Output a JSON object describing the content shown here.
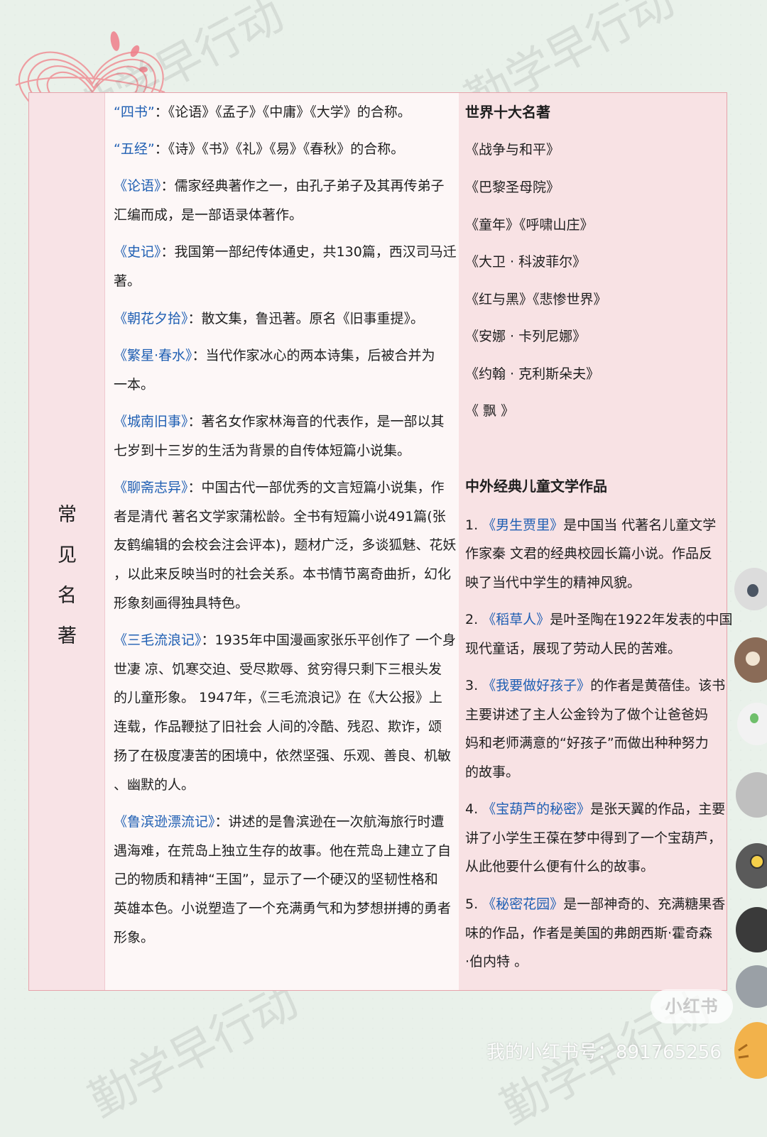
{
  "watermark": "勤学早行动",
  "title_chars": [
    "常",
    "见",
    "名",
    "著"
  ],
  "left_lines": [
    [
      {
        "t": "“四书”",
        "c": true
      },
      {
        "t": "：《论语》《孟子》《中庸》《大学》的合称。"
      }
    ],
    [
      {
        "t": "“五经”",
        "c": true
      },
      {
        "t": "：《诗》《书》《礼》《易》《春秋》的合称。"
      }
    ],
    [
      {
        "t": "《论语》",
        "c": true
      },
      {
        "t": "：儒家经典著作之一，由孔子弟子及其再传弟子"
      }
    ],
    [
      {
        "t": "汇编而成，是一部语录体著作。"
      }
    ],
    [
      {
        "t": "《史记》",
        "c": true
      },
      {
        "t": "：我国第一部纪传体通史，共130篇，西汉司马迁"
      }
    ],
    [
      {
        "t": "著。"
      }
    ],
    [
      {
        "t": "《朝花夕拾》",
        "c": true
      },
      {
        "t": "：散文集，鲁迅著。原名《旧事重提》。"
      }
    ],
    [
      {
        "t": "《繁星·春水》",
        "c": true
      },
      {
        "t": "：当代作家冰心的两本诗集，后被合并为"
      }
    ],
    [
      {
        "t": "一本。"
      }
    ],
    [
      {
        "t": "《城南旧事》",
        "c": true
      },
      {
        "t": "：著名女作家林海音的代表作，是一部以其"
      }
    ],
    [
      {
        "t": "七岁到十三岁的生活为背景的自传体短篇小说集。"
      }
    ],
    [
      {
        "t": "《聊斋志异》",
        "c": true
      },
      {
        "t": "：中国古代一部优秀的文言短篇小说集，作"
      }
    ],
    [
      {
        "t": "者是清代 著名文学家蒲松龄。全书有短篇小说491篇(张"
      }
    ],
    [
      {
        "t": "友鹤编辑的会校会注会评本)，题材广泛，多谈狐魅、花妖"
      }
    ],
    [
      {
        "t": "，以此来反映当时的社会关系。本书情节离奇曲折，幻化"
      }
    ],
    [
      {
        "t": "形象刻画得独具特色。"
      }
    ],
    [
      {
        "t": "《三毛流浪记》",
        "c": true
      },
      {
        "t": "：1935年中国漫画家张乐平创作了 一个身"
      }
    ],
    [
      {
        "t": "世凄 凉、饥寒交迫、受尽欺辱、贫穷得只剩下三根头发"
      }
    ],
    [
      {
        "t": "的儿童形象。 1947年，《三毛流浪记》在《大公报》上"
      }
    ],
    [
      {
        "t": "连载，作品鞭挞了旧社会 人间的冷酷、残忍、欺诈，颂"
      }
    ],
    [
      {
        "t": "扬了在极度凄苦的困境中，依然坚强、乐观、善良、机敏"
      }
    ],
    [
      {
        "t": "、幽默的人。"
      }
    ],
    [
      {
        "t": "《鲁滨逊漂流记》",
        "c": true
      },
      {
        "t": "：讲述的是鲁滨逊在一次航海旅行时遭"
      }
    ],
    [
      {
        "t": "遇海难，在荒岛上独立生存的故事。他在荒岛上建立了自"
      }
    ],
    [
      {
        "t": "己的物质和精神“王国”，显示了一个硬汉的坚韧性格和"
      }
    ],
    [
      {
        "t": "英雄本色。小说塑造了一个充满勇气和为梦想拼搏的勇者"
      }
    ],
    [
      {
        "t": "形象。"
      }
    ]
  ],
  "right_lines": [
    [
      {
        "t": "世界十大名著",
        "h": true
      }
    ],
    [
      {
        "t": "《战争与和平》"
      }
    ],
    [
      {
        "t": "《巴黎圣母院》"
      }
    ],
    [
      {
        "t": "《童年》《呼啸山庄》"
      }
    ],
    [
      {
        "t": "《大卫 · 科波菲尔》"
      }
    ],
    [
      {
        "t": "《红与黑》《悲惨世界》"
      }
    ],
    [
      {
        "t": "《安娜 · 卡列尼娜》"
      }
    ],
    [
      {
        "t": "《约翰 · 克利斯朵夫》"
      }
    ],
    [
      {
        "t": "《 飘 》"
      }
    ],
    [
      {
        "t": "中外经典儿童文学作品",
        "h": true
      }
    ],
    [
      {
        "t": "1. "
      },
      {
        "t": "《男生贾里》",
        "c": true
      },
      {
        "t": "是中国当 代著名儿童文学"
      }
    ],
    [
      {
        "t": "作家秦 文君的经典校园长篇小说。作品反"
      }
    ],
    [
      {
        "t": "映了当代中学生的精神风貌。"
      }
    ],
    [
      {
        "t": "2. "
      },
      {
        "t": "《稻草人》",
        "c": true
      },
      {
        "t": "是叶圣陶在1922年发表的中国"
      }
    ],
    [
      {
        "t": "现代童话，展现了劳动人民的苦难。"
      }
    ],
    [
      {
        "t": "3. "
      },
      {
        "t": "《我要做好孩子》",
        "c": true
      },
      {
        "t": "的作者是黄蓓佳。该书"
      }
    ],
    [
      {
        "t": "主要讲述了主人公金铃为了做个让爸爸妈"
      }
    ],
    [
      {
        "t": "妈和老师满意的“好孩子”而做出种种努力"
      }
    ],
    [
      {
        "t": "的故事。"
      }
    ],
    [
      {
        "t": "4. "
      },
      {
        "t": "《宝葫芦的秘密》",
        "c": true
      },
      {
        "t": "是张天翼的作品，主要"
      }
    ],
    [
      {
        "t": "讲了小学生王葆在梦中得到了一个宝葫芦，"
      }
    ],
    [
      {
        "t": "从此他要什么便有什么的故事。"
      }
    ],
    [
      {
        "t": "5. "
      },
      {
        "t": "《秘密花园》",
        "c": true
      },
      {
        "t": "是一部神奇的、充满糖果香"
      }
    ],
    [
      {
        "t": "味的作品，作者是美国的弗朗西斯·霍奇森"
      }
    ],
    [
      {
        "t": "·伯内特 。"
      }
    ]
  ],
  "footer": {
    "logo": "小红书",
    "id_text": "我的小红书号：891765256"
  },
  "colors": {
    "accent_blue": "#1f5fb3",
    "border_pink": "#e6a3ab"
  }
}
